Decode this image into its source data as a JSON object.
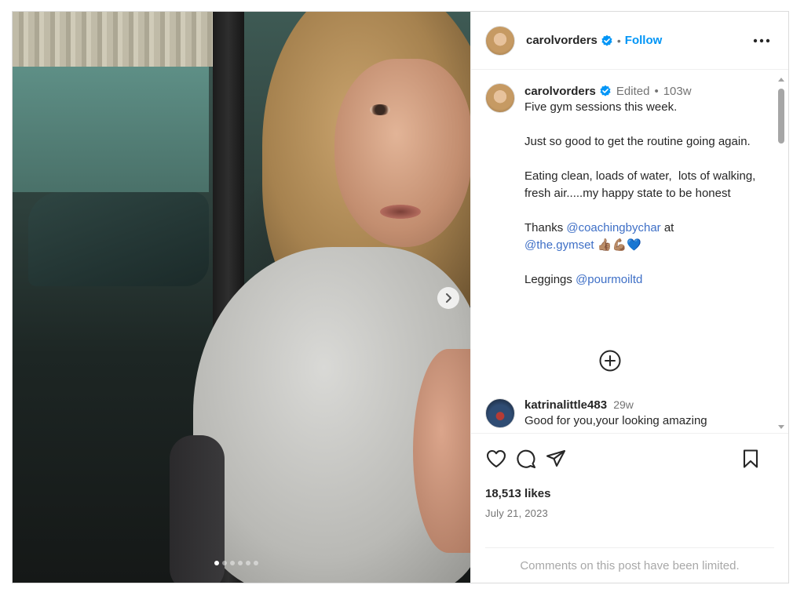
{
  "post": {
    "username": "carolvorders",
    "follow_label": "Follow",
    "separator": "•",
    "caption_meta": {
      "edited": "Edited",
      "dot": "•",
      "age": "103w"
    },
    "caption_paragraphs": {
      "p1": "Five gym sessions this week.",
      "p2": "Just so good to get the routine going again.",
      "p3": "Eating clean, loads of water,  lots of walking, fresh air.....my happy state to be honest",
      "p4_prefix": "Thanks ",
      "p4_mention1": "@coachingbychar",
      "p4_middle": " at",
      "p4_mention2": "@the.gymset",
      "p4_emoji": " 👍🏽💪🏽💙",
      "p5_prefix": "Leggings ",
      "p5_mention": "@pourmoiltd"
    },
    "comment": {
      "username": "katrinalittle483",
      "age": "29w",
      "text": "Good for you,your looking amazing"
    },
    "likes": "18,513 likes",
    "date": "July 21, 2023",
    "comments_limited": "Comments on this post have been limited.",
    "carousel": {
      "total_slides": 6,
      "active_slide": 1
    }
  },
  "icons": {
    "verified": "verified-badge-icon",
    "more": "more-options-icon",
    "next": "chevron-right-icon",
    "load_more": "plus-circle-icon",
    "like": "heart-icon",
    "comment": "comment-icon",
    "share": "paper-plane-icon",
    "save": "bookmark-icon"
  },
  "colors": {
    "link": "#0095f6",
    "text": "#262626",
    "muted": "#737373",
    "border": "#dbdbdb"
  }
}
